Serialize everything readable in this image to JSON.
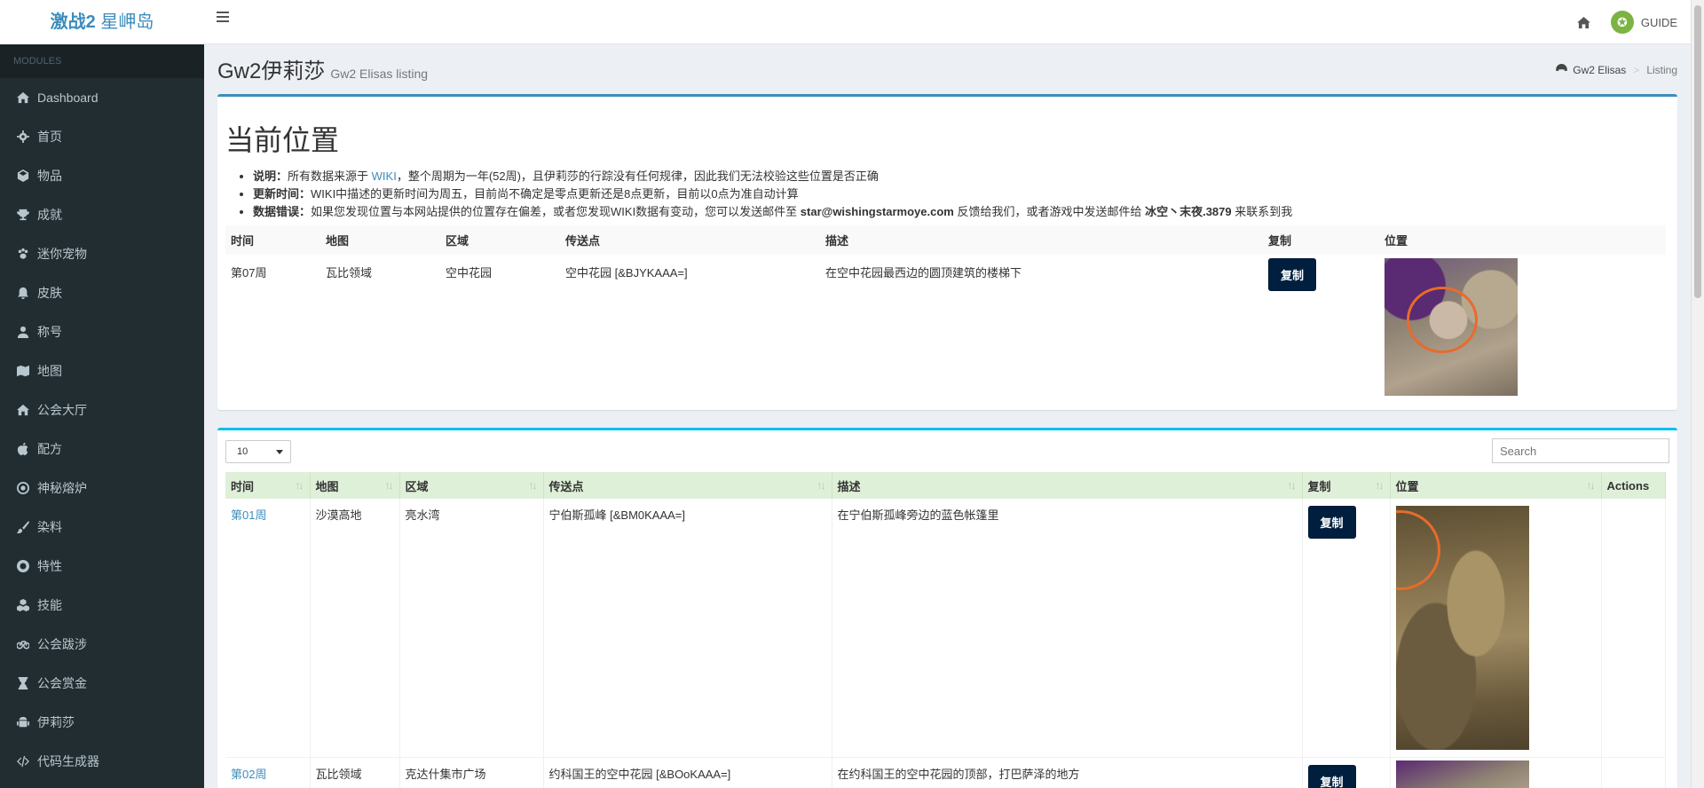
{
  "logo": {
    "bold": "激战2",
    "rest": " 星岬岛"
  },
  "header": {
    "user_label": "GUIDE"
  },
  "sidebar": {
    "header": "MODULES",
    "items": [
      {
        "label": "Dashboard",
        "icon": "dashboard-icon"
      },
      {
        "label": "首页",
        "icon": "gear-icon"
      },
      {
        "label": "物品",
        "icon": "cube-icon"
      },
      {
        "label": "成就",
        "icon": "trophy-icon"
      },
      {
        "label": "迷你宠物",
        "icon": "paw-icon"
      },
      {
        "label": "皮肤",
        "icon": "bell-icon"
      },
      {
        "label": "称号",
        "icon": "user-icon"
      },
      {
        "label": "地图",
        "icon": "map-icon"
      },
      {
        "label": "公会大厅",
        "icon": "home-icon"
      },
      {
        "label": "配方",
        "icon": "apple-icon"
      },
      {
        "label": "神秘熔炉",
        "icon": "dot-circle-icon"
      },
      {
        "label": "染料",
        "icon": "brush-icon"
      },
      {
        "label": "特性",
        "icon": "support-icon"
      },
      {
        "label": "技能",
        "icon": "cubes-icon"
      },
      {
        "label": "公会跋涉",
        "icon": "bicycle-icon"
      },
      {
        "label": "公会赏金",
        "icon": "hourglass-icon"
      },
      {
        "label": "伊莉莎",
        "icon": "android-icon"
      },
      {
        "label": "代码生成器",
        "icon": "code-icon"
      }
    ]
  },
  "page": {
    "title": "Gw2伊莉莎",
    "subtitle": "Gw2 Elisas listing",
    "breadcrumb": [
      "Gw2 Elisas",
      "Listing"
    ]
  },
  "current": {
    "title": "当前位置",
    "notes": [
      {
        "label": "说明：",
        "pre": "所有数据来源于 ",
        "link": "WIKI",
        "post": "，整个周期为一年(52周)，且伊莉莎的行踪没有任何规律，因此我们无法校验这些位置是否正确"
      },
      {
        "label": "更新时间：",
        "pre": "WIKI中描述的更新时间为周五，目前尚不确定是零点更新还是8点更新，目前以0点为准自动计算",
        "link": "",
        "post": ""
      },
      {
        "label": "数据错误：",
        "pre": "如果您发现位置与本网站提供的位置存在偏差，或者您发现WIKI数据有变动，您可以发送邮件至 ",
        "email": "star@wishingstarmoye.com",
        "mid": " 反馈给我们，或者游戏中发送邮件给 ",
        "ign": "冰空丶末夜.3879",
        "post": " 来联系到我"
      }
    ],
    "columns": [
      "时间",
      "地图",
      "区域",
      "传送点",
      "描述",
      "复制",
      "位置"
    ],
    "row": {
      "week": "第07周",
      "map": "瓦比领域",
      "region": "空中花园",
      "waypoint": "空中花园 [&BJYKAAA=]",
      "desc": "在空中花园最西边的圆顶建筑的楼梯下",
      "copy": "复制"
    }
  },
  "listing": {
    "page_size": "10",
    "search_placeholder": "Search",
    "columns": [
      "时间",
      "地图",
      "区域",
      "传送点",
      "描述",
      "复制",
      "位置",
      "Actions"
    ],
    "rows": [
      {
        "week": "第01周",
        "map": "沙漠高地",
        "region": "亮水湾",
        "waypoint": "宁伯斯孤峰 [&BM0KAAA=]",
        "desc": "在宁伯斯孤峰旁边的蓝色帐篷里",
        "copy": "复制"
      },
      {
        "week": "第02周",
        "map": "瓦比领域",
        "region": "克达什集市广场",
        "waypoint": "约科国王的空中花园 [&BOoKAAA=]",
        "desc": "在约科国王的空中花园的顶部，打巴萨泽的地方",
        "copy": "复制"
      }
    ]
  },
  "colors": {
    "sidebar_bg": "#222d32",
    "accent": "#3c8dbc",
    "button": "#001f3f",
    "table_header": "#dff0d8"
  }
}
